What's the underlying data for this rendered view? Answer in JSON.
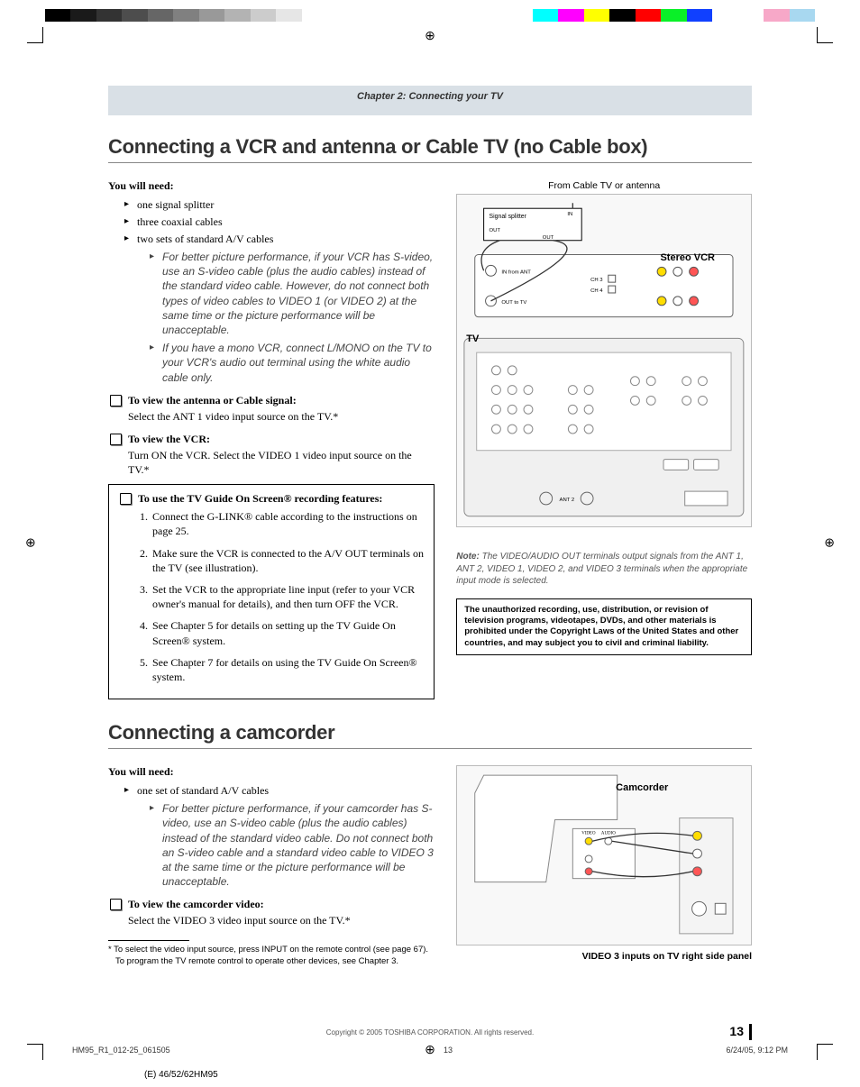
{
  "printers_marks": {
    "colors": [
      "#000",
      "#222",
      "#444",
      "#666",
      "#888",
      "#aaa",
      "#ccc",
      "#eee",
      "#fff",
      "#fff",
      "#fff",
      "#fff",
      "#fff",
      "#fff",
      "#0ff",
      "#f0f",
      "#ff0",
      "#000",
      "#f00",
      "#0f0",
      "#00f",
      "#fff",
      "#fff",
      "#f7c",
      "#9cf"
    ]
  },
  "chapter_header": "Chapter 2: Connecting your TV",
  "section1": {
    "title": "Connecting a VCR and antenna or Cable TV (no Cable box)",
    "needs_label": "You will need:",
    "needs": [
      "one signal splitter",
      "three coaxial cables",
      "two sets of standard A/V cables"
    ],
    "tips": [
      "For better picture performance, if your VCR has S-video, use an S-video cable (plus the audio cables) instead of the standard video cable. However, do not connect both types of video cables to VIDEO 1 (or VIDEO 2) at the same time or the picture performance will be unacceptable.",
      "If you have a mono VCR, connect L/MONO on the TV to your VCR's audio out terminal using the white audio cable only."
    ],
    "view_ant_head": "To view the antenna or Cable signal:",
    "view_ant_body": "Select the ANT 1 video input source on the TV.*",
    "view_vcr_head": "To view the VCR:",
    "view_vcr_body": "Turn ON the VCR. Select the VIDEO 1 video input source on the TV.*",
    "tvguide_head": "To use the TV Guide On Screen® recording features:",
    "tvguide_steps": [
      "Connect the G-LINK® cable according to the instructions on page 25.",
      "Make sure the VCR is connected to the A/V OUT terminals on the TV (see illustration).",
      "Set the VCR to the appropriate line input (refer to your VCR owner's manual for details), and then turn OFF the VCR.",
      "See Chapter 5 for details on setting up the TV Guide On Screen® system.",
      "See Chapter 7 for details on using the TV Guide On Screen® system."
    ],
    "diagram": {
      "from_label": "From Cable TV or antenna",
      "splitter": "Signal splitter",
      "in": "IN",
      "out": "OUT",
      "stereo_vcr": "Stereo VCR",
      "tv": "TV",
      "in_from_ant": "IN from ANT",
      "out_to_tv": "OUT to TV",
      "ch3": "CH 3",
      "ch4": "CH 4"
    },
    "note": {
      "label": "Note:",
      "text": "The VIDEO/AUDIO OUT terminals output signals from the ANT 1, ANT 2, VIDEO 1, VIDEO 2, and VIDEO 3 terminals when the appropriate input mode is selected."
    },
    "warn": "The unauthorized recording, use, distribution, or revision of television programs, videotapes, DVDs, and other materials is prohibited under the Copyright Laws of the United States and other countries, and may subject you to civil and criminal liability."
  },
  "section2": {
    "title": "Connecting a camcorder",
    "needs_label": "You will need:",
    "needs": [
      "one set of standard A/V cables"
    ],
    "tip": "For better picture performance, if your camcorder has S-video, use an S-video cable (plus the audio cables) instead of the standard video cable. Do not connect both an S-video cable and a standard video cable to VIDEO 3 at the same time or the picture performance will be unacceptable.",
    "view_cam_head": "To view the camcorder video:",
    "view_cam_body": "Select the VIDEO 3 video input source on the TV.*",
    "footnote": "* To select the video input source, press INPUT on the remote control (see page 67). To program the TV remote control to operate other devices, see Chapter 3.",
    "footnote_l2": "To program the TV remote control to operate other devices, see Chapter 3.",
    "footnote_l1": "* To select the video input source, press INPUT on the remote control (see page 67).",
    "camcorder_label": "Camcorder",
    "v3_caption": "VIDEO 3 inputs on TV right side panel"
  },
  "footer": {
    "copyright": "Copyright © 2005 TOSHIBA CORPORATION. All rights reserved.",
    "page": "13",
    "slug_file": "HM95_R1_012-25_061505",
    "slug_page": "13",
    "slug_date": "6/24/05, 9:12 PM",
    "model": "(E) 46/52/62HM95"
  }
}
